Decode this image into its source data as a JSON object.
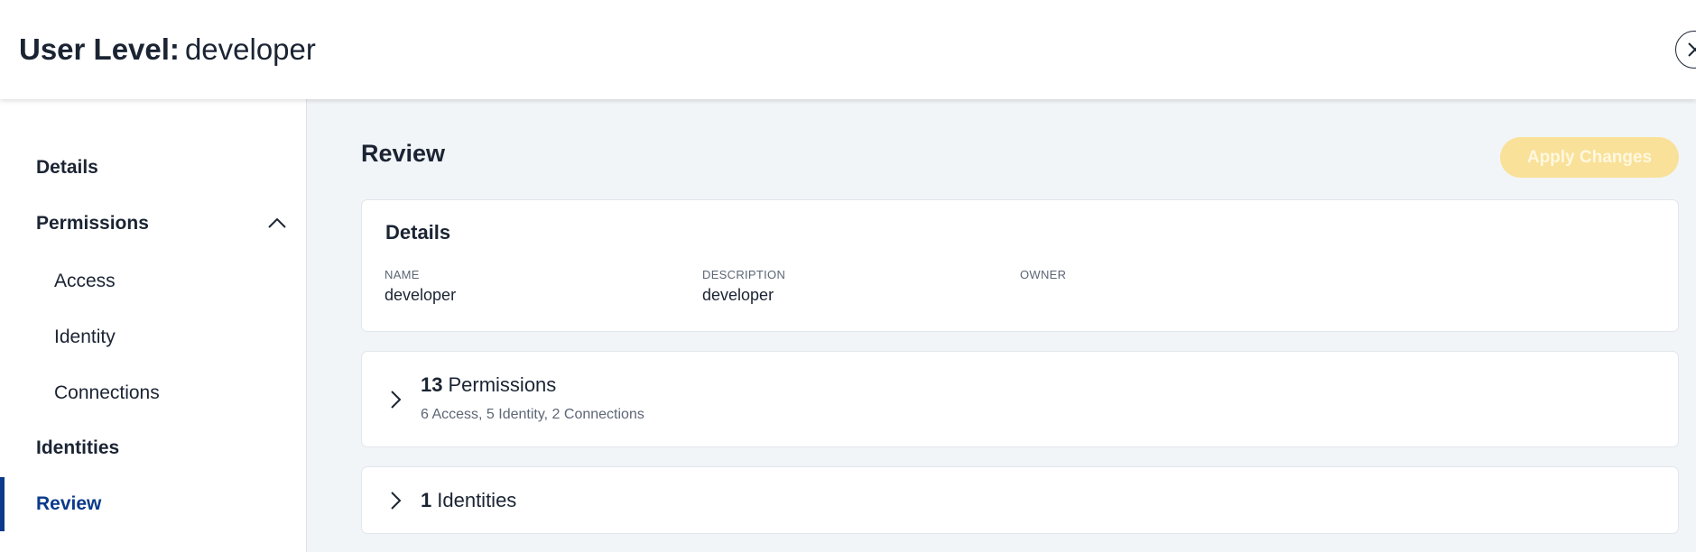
{
  "header": {
    "title_prefix": "User Level:",
    "title_name": "developer",
    "close_icon": "close-icon"
  },
  "sidebar": {
    "items": [
      {
        "label": "Details",
        "level": "top",
        "active": false
      },
      {
        "label": "Permissions",
        "level": "top",
        "active": false,
        "expanded": true
      },
      {
        "label": "Access",
        "level": "sub",
        "active": false
      },
      {
        "label": "Identity",
        "level": "sub",
        "active": false
      },
      {
        "label": "Connections",
        "level": "sub",
        "active": false
      },
      {
        "label": "Identities",
        "level": "top",
        "active": false
      },
      {
        "label": "Review",
        "level": "top",
        "active": true
      }
    ]
  },
  "main": {
    "title": "Review",
    "apply_label": "Apply Changes",
    "details_card": {
      "title": "Details",
      "fields": [
        {
          "label": "NAME",
          "value": "developer"
        },
        {
          "label": "DESCRIPTION",
          "value": "developer"
        },
        {
          "label": "OWNER",
          "value": ""
        }
      ]
    },
    "permissions_card": {
      "count": "13",
      "label": "Permissions",
      "summary": "6 Access, 5 Identity, 2 Connections"
    },
    "identities_card": {
      "count": "1",
      "label": "Identities"
    }
  },
  "colors": {
    "accent": "#0b3a8c",
    "apply_button_bg": "#f9e199",
    "page_bg": "#f2f5f8",
    "text": "#1b2433"
  }
}
